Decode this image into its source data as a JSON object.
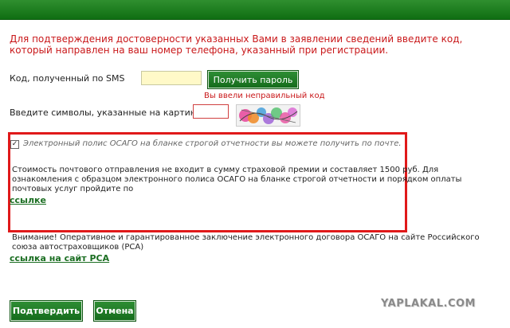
{
  "notice": {
    "text": "Для подтверждения достоверности указанных Вами в заявлении сведений введите код, который направлен на ваш номер телефона, указанный при регистрации."
  },
  "sms": {
    "label": "Код, полученный по SMS",
    "value": "",
    "button_label": "Получить пароль"
  },
  "captcha": {
    "error": "Вы ввели неправильный код",
    "label": "Введите символы, указанные на картинке:",
    "value": ""
  },
  "options": {
    "checked": true,
    "check_mark": "✓",
    "polis_text": "Электронный полис ОСАГО на бланке строгой отчетности вы можете получить по почте.",
    "cost_text": "Стоимость почтового отправления не входит в сумму страховой премии и составляет 1500 руб. Для ознакомления с образцом электронного полиса ОСАГО на бланке строгой отчетности и порядком оплаты почтовых услуг пройдите по",
    "link_label": "ссылке"
  },
  "warning": {
    "text": "Внимание! Оперативное и гарантированное заключение электронного договора ОСАГО на сайте Российского союза автостраховщиков (РСА)",
    "link_label": "ссылка на сайт РСА"
  },
  "actions": {
    "confirm_label": "Подтвердить",
    "cancel_label": "Отмена"
  },
  "watermark": "YAPLAKAL.COM",
  "colors": {
    "accent_green": "#146a1b",
    "error_red": "#c9181a",
    "input_yellow": "#fff9c8"
  }
}
